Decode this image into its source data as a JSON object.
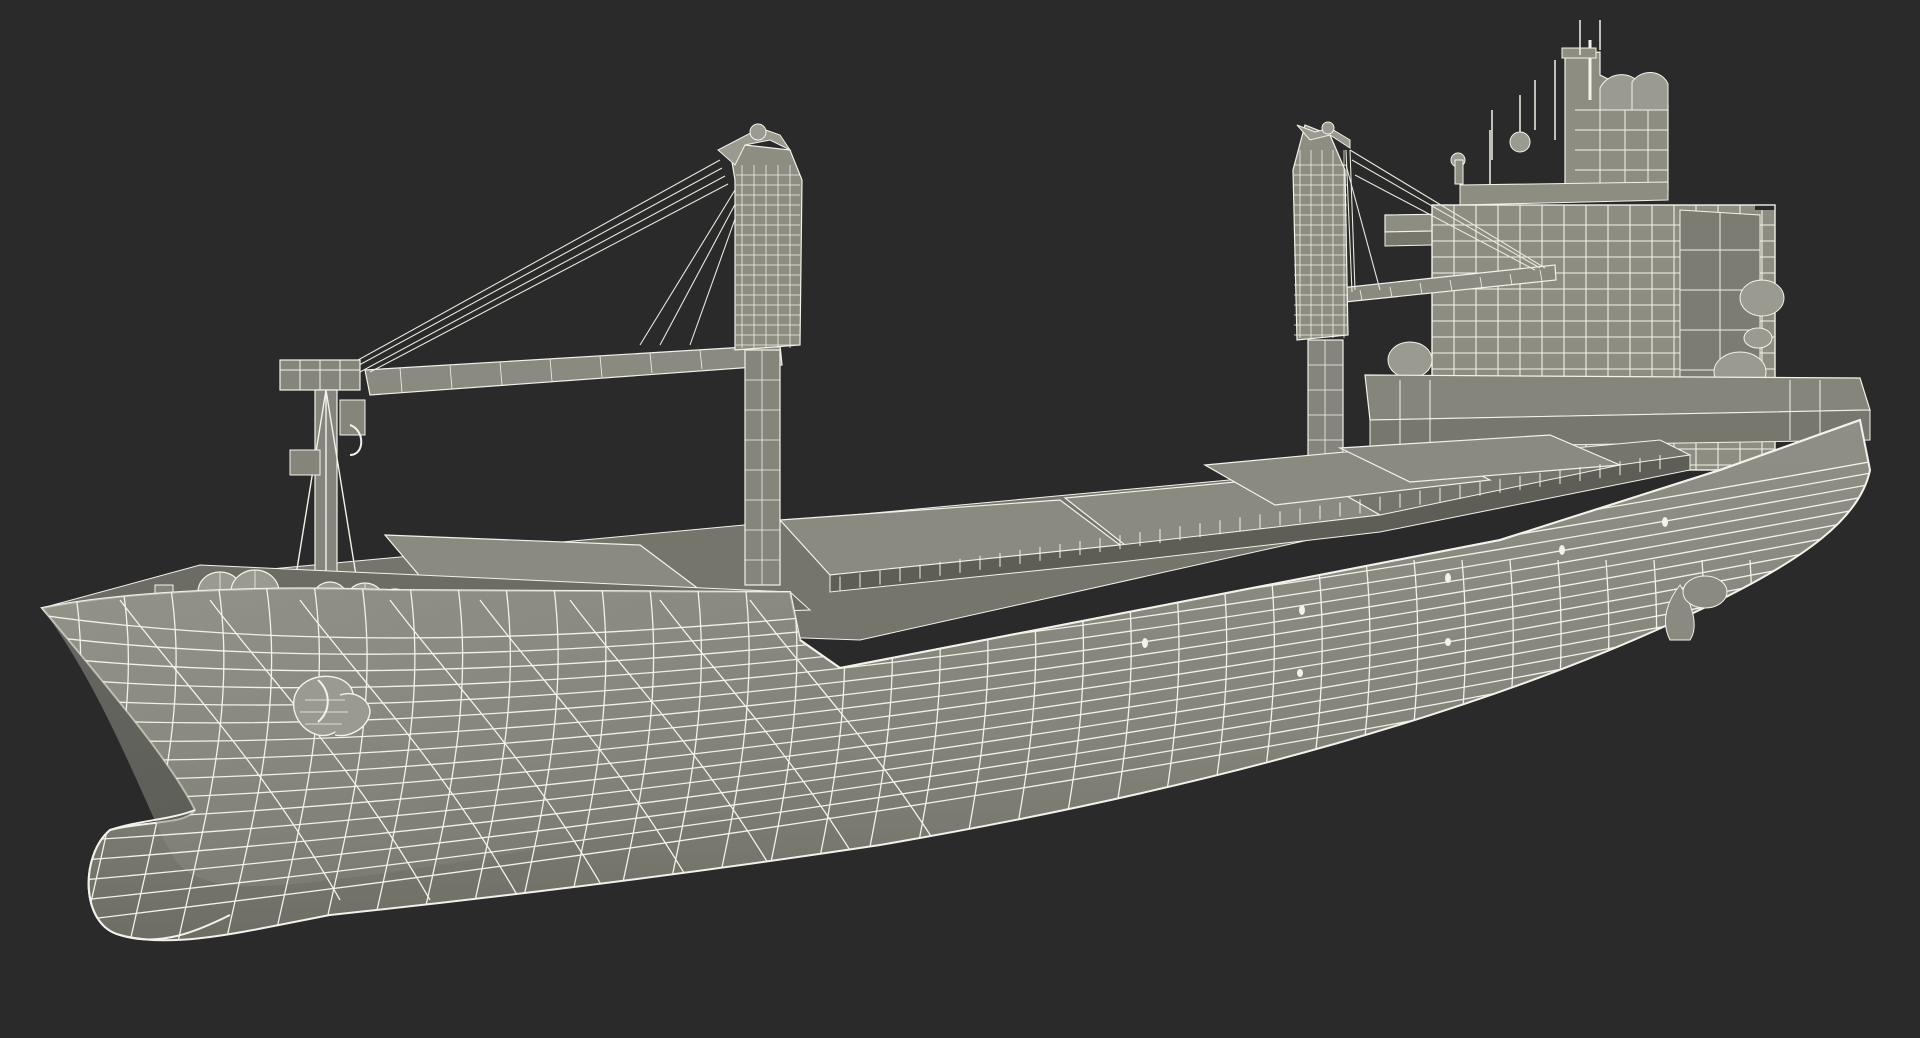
{
  "scene": {
    "background_color": "#2a2a2a",
    "subject": "cargo-ship-wireframe",
    "colors": {
      "hull_fill": "#84847a",
      "hull_fill_dark": "#6f6f66",
      "deck_fill": "#7d7d73",
      "hatch_fill": "#8a8a80",
      "superstructure_fill": "#8d8d82",
      "wire": "#f2f2ea",
      "wire_dim": "#d9d9cf",
      "shadow": "#55554e"
    },
    "objects": [
      "hull",
      "bulbous-bow",
      "anchor",
      "forecastle",
      "cargo-hatches",
      "crane-fore",
      "crane-aft",
      "mast-fore",
      "superstructure",
      "funnel"
    ]
  }
}
